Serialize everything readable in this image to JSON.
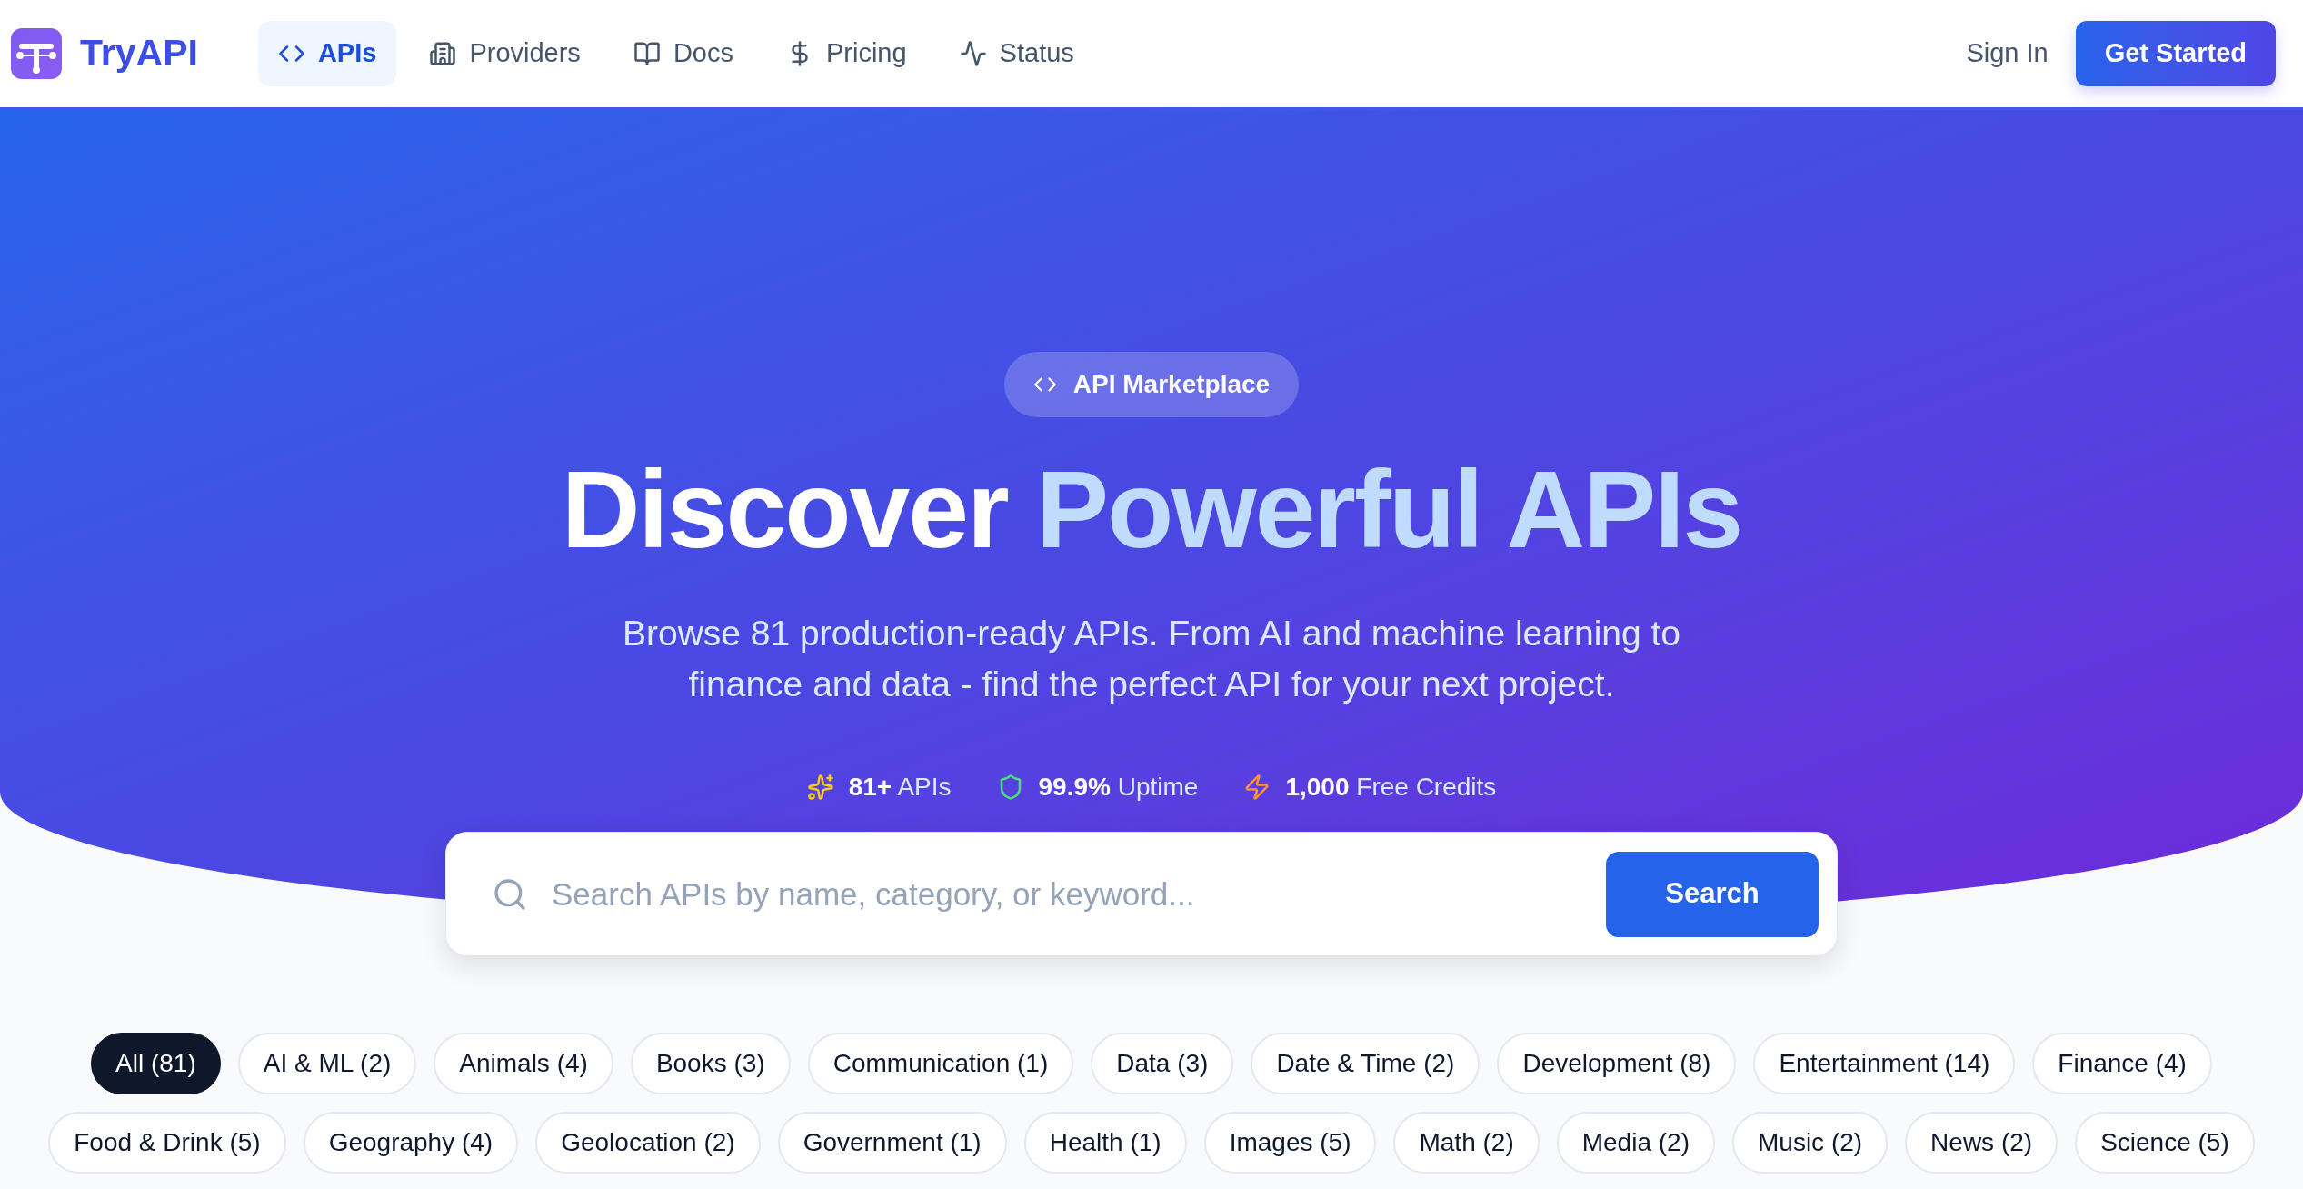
{
  "header": {
    "brand": "TryAPI",
    "nav": [
      {
        "label": "APIs",
        "selected": true
      },
      {
        "label": "Providers",
        "selected": false
      },
      {
        "label": "Docs",
        "selected": false
      },
      {
        "label": "Pricing",
        "selected": false
      },
      {
        "label": "Status",
        "selected": false
      }
    ],
    "sign_in": "Sign In",
    "get_started": "Get Started"
  },
  "hero": {
    "badge": "API Marketplace",
    "title_plain": "Discover",
    "title_accent": "Powerful APIs",
    "subtitle": "Browse 81 production-ready APIs. From AI and machine learning to finance and data - find the perfect API for your next project.",
    "stats": [
      {
        "value": "81+",
        "label": "APIs"
      },
      {
        "value": "99.9%",
        "label": "Uptime"
      },
      {
        "value": "1,000",
        "label": "Free Credits"
      }
    ]
  },
  "search": {
    "placeholder": "Search APIs by name, category, or keyword...",
    "button": "Search"
  },
  "categories": [
    {
      "label": "All (81)",
      "selected": true
    },
    {
      "label": "AI & ML (2)",
      "selected": false
    },
    {
      "label": "Animals (4)",
      "selected": false
    },
    {
      "label": "Books (3)",
      "selected": false
    },
    {
      "label": "Communication (1)",
      "selected": false
    },
    {
      "label": "Data (3)",
      "selected": false
    },
    {
      "label": "Date & Time (2)",
      "selected": false
    },
    {
      "label": "Development (8)",
      "selected": false
    },
    {
      "label": "Entertainment (14)",
      "selected": false
    },
    {
      "label": "Finance (4)",
      "selected": false
    },
    {
      "label": "Food & Drink (5)",
      "selected": false
    },
    {
      "label": "Geography (4)",
      "selected": false
    },
    {
      "label": "Geolocation (2)",
      "selected": false
    },
    {
      "label": "Government (1)",
      "selected": false
    },
    {
      "label": "Health (1)",
      "selected": false
    },
    {
      "label": "Images (5)",
      "selected": false
    },
    {
      "label": "Math (2)",
      "selected": false
    },
    {
      "label": "Media (2)",
      "selected": false
    },
    {
      "label": "Music (2)",
      "selected": false
    },
    {
      "label": "News (2)",
      "selected": false
    },
    {
      "label": "Science (5)",
      "selected": false
    }
  ]
}
